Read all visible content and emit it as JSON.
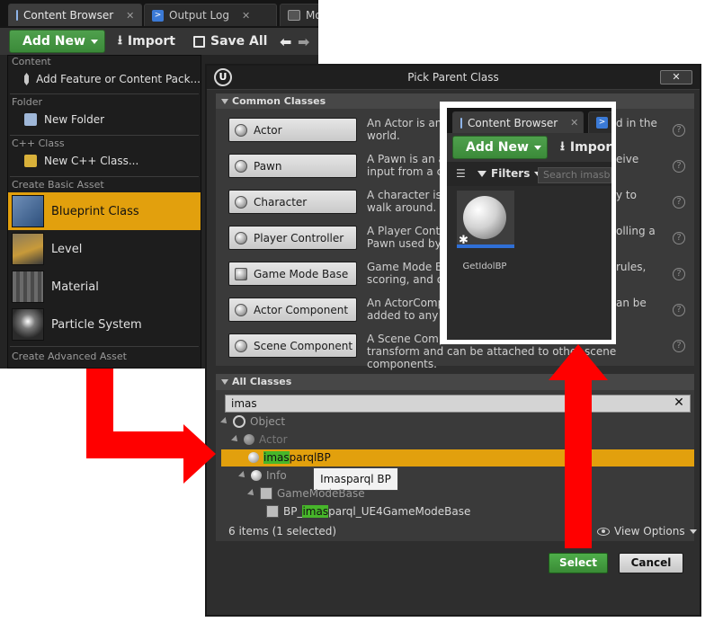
{
  "editor": {
    "tabs": [
      {
        "label": "Content Browser",
        "close": "✕"
      },
      {
        "label": "Output Log",
        "close": "✕"
      },
      {
        "label": "Mo"
      }
    ],
    "toolbar": {
      "add_new": "Add New",
      "import": "Import",
      "save_all": "Save All"
    },
    "menu": {
      "content_head": "Content",
      "add_feature": "Add Feature or Content Pack...",
      "folder_head": "Folder",
      "new_folder": "New Folder",
      "cpp_head": "C++ Class",
      "new_cpp": "New C++ Class...",
      "basic_head": "Create Basic Asset",
      "basic_items": [
        "Blueprint Class",
        "Level",
        "Material",
        "Particle System"
      ],
      "advanced_head": "Create Advanced Asset"
    }
  },
  "dialog": {
    "title": "Pick Parent Class",
    "logo": "U",
    "close": "✕",
    "common_head": "Common Classes",
    "classes": [
      {
        "name": "Actor",
        "desc": [
          "An Actor is an o",
          "world."
        ],
        "desc_right": [
          "d in the",
          ""
        ]
      },
      {
        "name": "Pawn",
        "desc": [
          "A Pawn is an a",
          "input from a co"
        ],
        "desc_right": [
          "eive",
          ""
        ]
      },
      {
        "name": "Character",
        "desc": [
          "A character is a",
          "walk around."
        ],
        "desc_right": [
          "y to",
          ""
        ]
      },
      {
        "name": "Player Controller",
        "desc": [
          "A Player Contro",
          "Pawn used by t"
        ],
        "desc_right": [
          "olling a",
          ""
        ]
      },
      {
        "name": "Game Mode Base",
        "desc": [
          "Game Mode Ba",
          "scoring, and ot"
        ],
        "desc_right": [
          "rules,",
          ""
        ]
      },
      {
        "name": "Actor Component",
        "desc": [
          "An ActorCompo",
          "added to any a"
        ],
        "desc_right": [
          "an be",
          ""
        ]
      },
      {
        "name": "Scene Component",
        "desc": [
          "A Scene Compo",
          "transform and can be attached to other scene components."
        ],
        "desc_right": [
          "",
          ""
        ]
      }
    ],
    "help": "?",
    "all_head": "All Classes",
    "search_value": "imas",
    "search_clear": "✕",
    "tree": {
      "object": "Object",
      "actor": "Actor",
      "selected_hl": "imas",
      "selected_rest": "parqlBP",
      "info": "Info",
      "gamemodebase": "GameModeBase",
      "bp_pre": "BP_",
      "bp_hl": "imas",
      "bp_rest": "parql_UE4GameModeBase"
    },
    "tooltip": "Imasparql BP",
    "status": "6 items (1 selected)",
    "view_options": "View Options",
    "select": "Select",
    "cancel": "Cancel"
  },
  "inset": {
    "tab": "Content Browser",
    "tab_close": "✕",
    "add_new": "Add New",
    "import": "Impor",
    "filters": "Filters",
    "search_placeholder": "Search imasbo",
    "asset_name": "GetIdolBP"
  },
  "colors": {
    "selection": "#e2a00d",
    "green": "#4fa04d",
    "highlight": "#47b62a",
    "arrow": "#ff0000"
  }
}
